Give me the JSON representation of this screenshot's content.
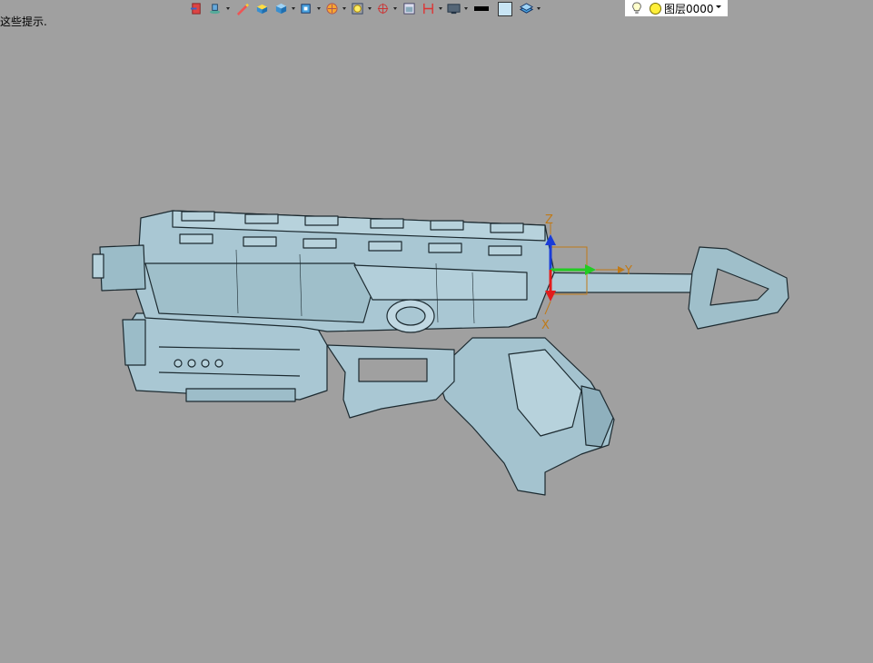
{
  "status": {
    "hint": "这些提示."
  },
  "toolbar": {
    "icons": [
      "exit-icon",
      "layers-icon",
      "pen-icon",
      "solid-icon",
      "shaded-view-icon",
      "view-cube-icon",
      "render-icon",
      "zoom-fit-icon",
      "orient-icon",
      "section-icon",
      "measure-icon",
      "display-icon"
    ],
    "line_color": "#000000",
    "fill_color": "#c8e4f4"
  },
  "layer": {
    "name": "图层0000"
  },
  "axes": {
    "z": "Z",
    "y": "Y",
    "x": "X"
  },
  "colors": {
    "background": "#a0a0a0",
    "model": "#a9c7d3",
    "z_axis": "#1a3cd8",
    "y_axis": "#22cc22",
    "x_axis": "#e21c1c",
    "label": "#c07a18"
  }
}
